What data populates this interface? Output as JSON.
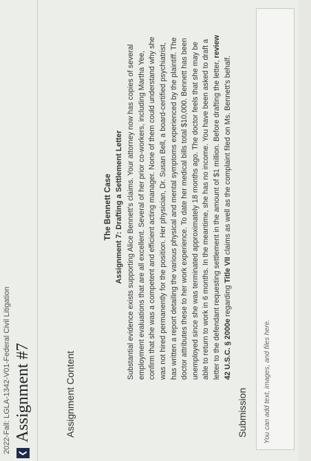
{
  "course": "2022-Fall: LGLA-1342-V01-Federal Civil Litigation",
  "page_title": "Assignment #7",
  "back_icon": "chevron-left-icon",
  "assignment_content_label": "Assignment Content",
  "case_title": "The Bennett Case",
  "assignment_heading": "Assignment 7: Drafting a Settlement Letter",
  "body": {
    "before_bold": "Substantial evidence exists supporting Alice Bennett's claims. Your attorney now has copies of several employment evaluations that are all excellent. Several of her prior co-workers, including Martha Yee, confirm that she was a competent and efficient acting manager. None of them could understand why she was not hired permanently for the position. Her physician, Dr. Susan Bell, a board-certified psychiatrist, has written a report detailing the various physical and mental symptoms experienced by the plaintiff. The doctor attributes these to her work experience. To date her medical bills total $10,000. Bennett has been unemployed since she was terminated approximately 18 months ago. The doctor feels that she may be able to return to work in 6 months. In the meantime, she has no income. You have been asked to draft a letter to the defendant requesting settlement in the amount of $1 million. Before drafting the letter, ",
    "bold_1": "review 42 U.S.C. § 2000e",
    "middle": " regarding ",
    "bold_2": "Title VII",
    "after_bold": " claims as well as the complaint filed on Ms. Bennett's behalf."
  },
  "submission_label": "Submission",
  "submission_placeholder": "You can add text, images, and files here."
}
